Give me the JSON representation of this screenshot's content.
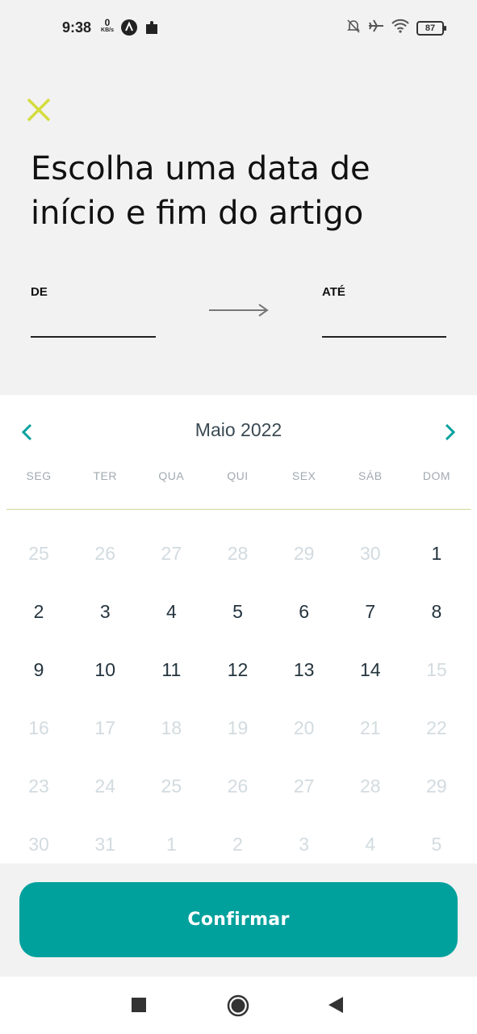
{
  "status_bar": {
    "time": "9:38",
    "net_speed": "0",
    "net_unit": "KB/s",
    "battery": "87",
    "icons_left": [
      "a-circle-icon",
      "puzzle-icon"
    ],
    "icons_right": [
      "bell-off-icon",
      "airplane-icon",
      "wifi-icon",
      "battery-icon"
    ]
  },
  "header": {
    "close_icon": "close-icon",
    "accent_color": "#d4dc3c",
    "title": "Escolha uma data de início e fim do artigo"
  },
  "range": {
    "from_label": "DE",
    "from_value": "",
    "to_label": "ATÉ",
    "to_value": "",
    "arrow_icon": "arrow-right-icon"
  },
  "calendar": {
    "month_label": "Maio 2022",
    "prev_icon": "chevron-left-icon",
    "next_icon": "chevron-right-icon",
    "nav_color": "#00a19d",
    "weekdays": [
      "SEG",
      "TER",
      "QUA",
      "QUI",
      "SEX",
      "SÁB",
      "DOM"
    ],
    "days": [
      {
        "label": "25",
        "muted": true
      },
      {
        "label": "26",
        "muted": true
      },
      {
        "label": "27",
        "muted": true
      },
      {
        "label": "28",
        "muted": true
      },
      {
        "label": "29",
        "muted": true
      },
      {
        "label": "30",
        "muted": true
      },
      {
        "label": "1",
        "muted": false
      },
      {
        "label": "2",
        "muted": false
      },
      {
        "label": "3",
        "muted": false
      },
      {
        "label": "4",
        "muted": false
      },
      {
        "label": "5",
        "muted": false
      },
      {
        "label": "6",
        "muted": false
      },
      {
        "label": "7",
        "muted": false
      },
      {
        "label": "8",
        "muted": false
      },
      {
        "label": "9",
        "muted": false
      },
      {
        "label": "10",
        "muted": false
      },
      {
        "label": "11",
        "muted": false
      },
      {
        "label": "12",
        "muted": false
      },
      {
        "label": "13",
        "muted": false
      },
      {
        "label": "14",
        "muted": false
      },
      {
        "label": "15",
        "muted": true
      },
      {
        "label": "16",
        "muted": true
      },
      {
        "label": "17",
        "muted": true
      },
      {
        "label": "18",
        "muted": true
      },
      {
        "label": "19",
        "muted": true
      },
      {
        "label": "20",
        "muted": true
      },
      {
        "label": "21",
        "muted": true
      },
      {
        "label": "22",
        "muted": true
      },
      {
        "label": "23",
        "muted": true
      },
      {
        "label": "24",
        "muted": true
      },
      {
        "label": "25",
        "muted": true
      },
      {
        "label": "26",
        "muted": true
      },
      {
        "label": "27",
        "muted": true
      },
      {
        "label": "28",
        "muted": true
      },
      {
        "label": "29",
        "muted": true
      },
      {
        "label": "30",
        "muted": true
      },
      {
        "label": "31",
        "muted": true
      },
      {
        "label": "1",
        "muted": true
      },
      {
        "label": "2",
        "muted": true
      },
      {
        "label": "3",
        "muted": true
      },
      {
        "label": "4",
        "muted": true
      },
      {
        "label": "5",
        "muted": true
      }
    ]
  },
  "confirm": {
    "label": "Confirmar",
    "color": "#00a19d"
  },
  "system_nav": {
    "recents_icon": "square-icon",
    "home_icon": "home-circle-icon",
    "back_icon": "back-triangle-icon"
  }
}
